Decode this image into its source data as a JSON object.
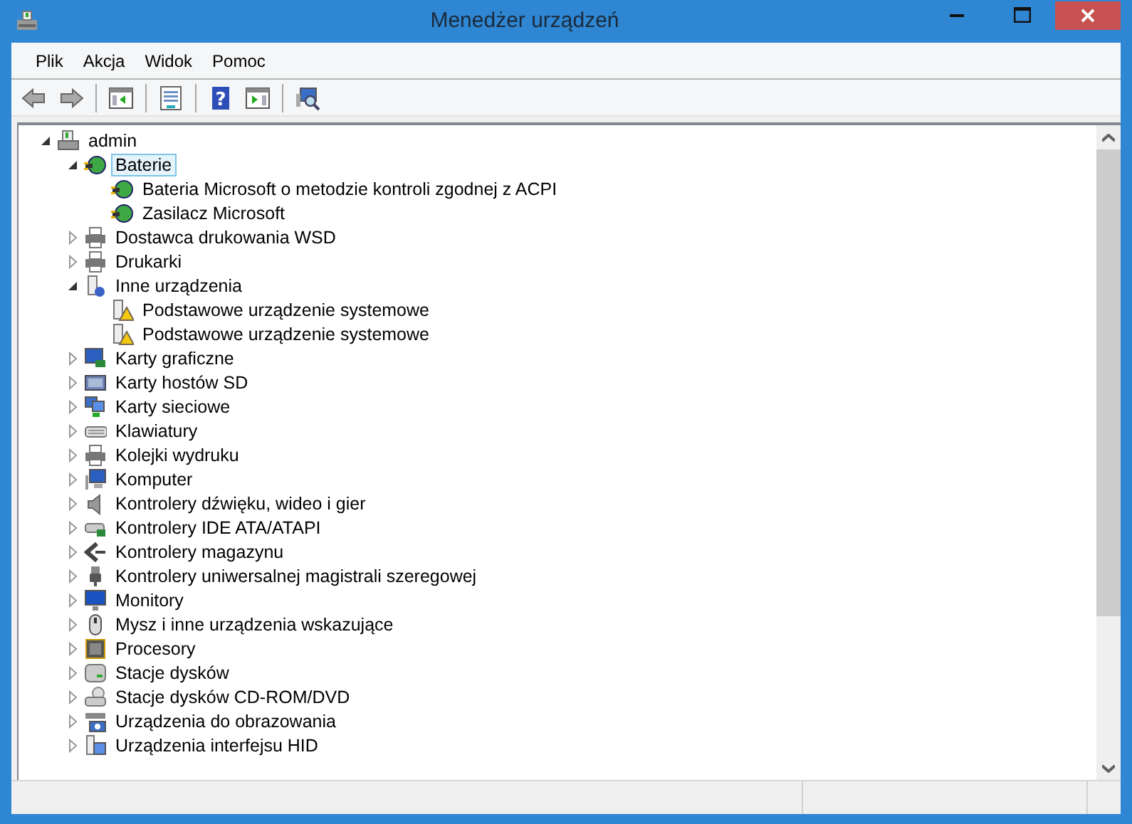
{
  "window": {
    "title": "Menedżer urządzeń"
  },
  "menu": [
    {
      "label": "Plik"
    },
    {
      "label": "Akcja"
    },
    {
      "label": "Widok"
    },
    {
      "label": "Pomoc"
    }
  ],
  "toolbar": [
    {
      "kind": "back",
      "disabled": true
    },
    {
      "kind": "forward",
      "disabled": true
    },
    {
      "kind": "separator"
    },
    {
      "kind": "console-tree",
      "disabled": false
    },
    {
      "kind": "separator"
    },
    {
      "kind": "properties",
      "disabled": false
    },
    {
      "kind": "separator"
    },
    {
      "kind": "help",
      "glyph": "?",
      "disabled": false
    },
    {
      "kind": "action-pane",
      "disabled": false
    },
    {
      "kind": "separator"
    },
    {
      "kind": "scan",
      "disabled": false
    }
  ],
  "tree": [
    {
      "label": "admin",
      "kind": "computer-root",
      "expanded": true,
      "selected": false,
      "children": [
        {
          "label": "Baterie",
          "kind": "battery",
          "expanded": true,
          "selected": true,
          "children": [
            {
              "label": "Bateria Microsoft o metodzie kontroli zgodnej z ACPI",
              "kind": "battery",
              "selected": false
            },
            {
              "label": "Zasilacz Microsoft",
              "kind": "battery",
              "selected": false
            }
          ]
        },
        {
          "label": "Dostawca drukowania WSD",
          "kind": "printer",
          "expanded": false,
          "selected": false
        },
        {
          "label": "Drukarki",
          "kind": "printer",
          "expanded": false,
          "selected": false
        },
        {
          "label": "Inne urządzenia",
          "kind": "unknown",
          "expanded": true,
          "selected": false,
          "children": [
            {
              "label": "Podstawowe urządzenie systemowe",
              "kind": "warning",
              "selected": false
            },
            {
              "label": "Podstawowe urządzenie systemowe",
              "kind": "warning",
              "selected": false
            }
          ]
        },
        {
          "label": "Karty graficzne",
          "kind": "display",
          "expanded": false,
          "selected": false
        },
        {
          "label": "Karty hostów SD",
          "kind": "sdhost",
          "expanded": false,
          "selected": false
        },
        {
          "label": "Karty sieciowe",
          "kind": "network",
          "expanded": false,
          "selected": false
        },
        {
          "label": "Klawiatury",
          "kind": "keyboard",
          "expanded": false,
          "selected": false
        },
        {
          "label": "Kolejki wydruku",
          "kind": "printer",
          "expanded": false,
          "selected": false
        },
        {
          "label": "Komputer",
          "kind": "computer",
          "expanded": false,
          "selected": false
        },
        {
          "label": "Kontrolery dźwięku, wideo i gier",
          "kind": "sound",
          "expanded": false,
          "selected": false
        },
        {
          "label": "Kontrolery IDE ATA/ATAPI",
          "kind": "ide",
          "expanded": false,
          "selected": false
        },
        {
          "label": "Kontrolery magazynu",
          "kind": "storage",
          "expanded": false,
          "selected": false
        },
        {
          "label": "Kontrolery uniwersalnej magistrali szeregowej",
          "kind": "usb",
          "expanded": false,
          "selected": false
        },
        {
          "label": "Monitory",
          "kind": "monitor",
          "expanded": false,
          "selected": false
        },
        {
          "label": "Mysz i inne urządzenia wskazujące",
          "kind": "mouse",
          "expanded": false,
          "selected": false
        },
        {
          "label": "Procesory",
          "kind": "cpu",
          "expanded": false,
          "selected": false
        },
        {
          "label": "Stacje dysków",
          "kind": "disk",
          "expanded": false,
          "selected": false
        },
        {
          "label": "Stacje dysków CD-ROM/DVD",
          "kind": "cdrom",
          "expanded": false,
          "selected": false
        },
        {
          "label": "Urządzenia do obrazowania",
          "kind": "camera",
          "expanded": false,
          "selected": false
        },
        {
          "label": "Urządzenia interfejsu HID",
          "kind": "hid",
          "expanded": false,
          "selected": false
        }
      ]
    }
  ]
}
